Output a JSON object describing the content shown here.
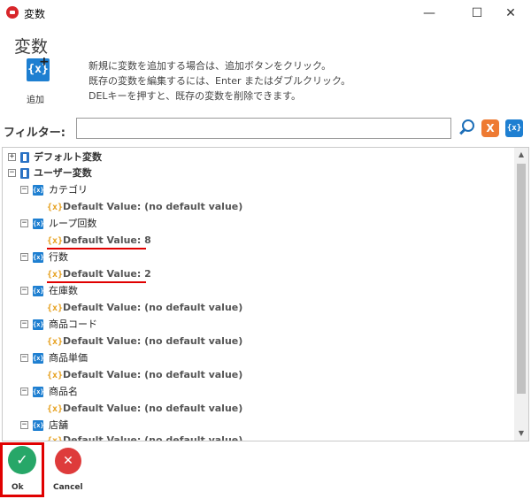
{
  "window": {
    "title": "変数",
    "minimize": "—",
    "maximize": "☐",
    "close": "✕"
  },
  "header": {
    "title": "変数",
    "add_label": "追加",
    "add_icon_text": "{x}",
    "help_lines": [
      "新規に変数を追加する場合は、追加ボタンをクリック。",
      "既存の変数を編集するには、Enter またはダブルクリック。",
      "DELキーを押すと、既存の変数を削除できます。"
    ]
  },
  "filter": {
    "label": "フィルター:",
    "value": "",
    "placeholder": "",
    "clear_icon": "X",
    "var_icon": "{x}"
  },
  "tree": {
    "groups": [
      {
        "label": "デフォルト変数",
        "expanded": false,
        "expander": "+"
      },
      {
        "label": "ユーザー変数",
        "expanded": true,
        "expander": "−"
      }
    ],
    "variables": [
      {
        "name": "カテゴリ",
        "default": "Default Value: (no default value)"
      },
      {
        "name": "ループ回数",
        "default": "Default Value: 8"
      },
      {
        "name": "行数",
        "default": "Default Value: 2"
      },
      {
        "name": "在庫数",
        "default": "Default Value: (no default value)"
      },
      {
        "name": "商品コード",
        "default": "Default Value: (no default value)"
      },
      {
        "name": "商品単価",
        "default": "Default Value: (no default value)"
      },
      {
        "name": "商品名",
        "default": "Default Value: (no default value)"
      },
      {
        "name": "店舗",
        "default": "Default Value: (no default value)"
      }
    ],
    "var_icon": "{x}",
    "default_icon": "{x}",
    "expander_minus": "−"
  },
  "footer": {
    "ok_label": "Ok",
    "cancel_label": "Cancel",
    "ok_icon": "✓",
    "cancel_icon": "✕"
  },
  "colors": {
    "highlight": "#e00000",
    "accent": "#1e7fd1",
    "ok": "#27a768",
    "cancel": "#de3b3b"
  }
}
